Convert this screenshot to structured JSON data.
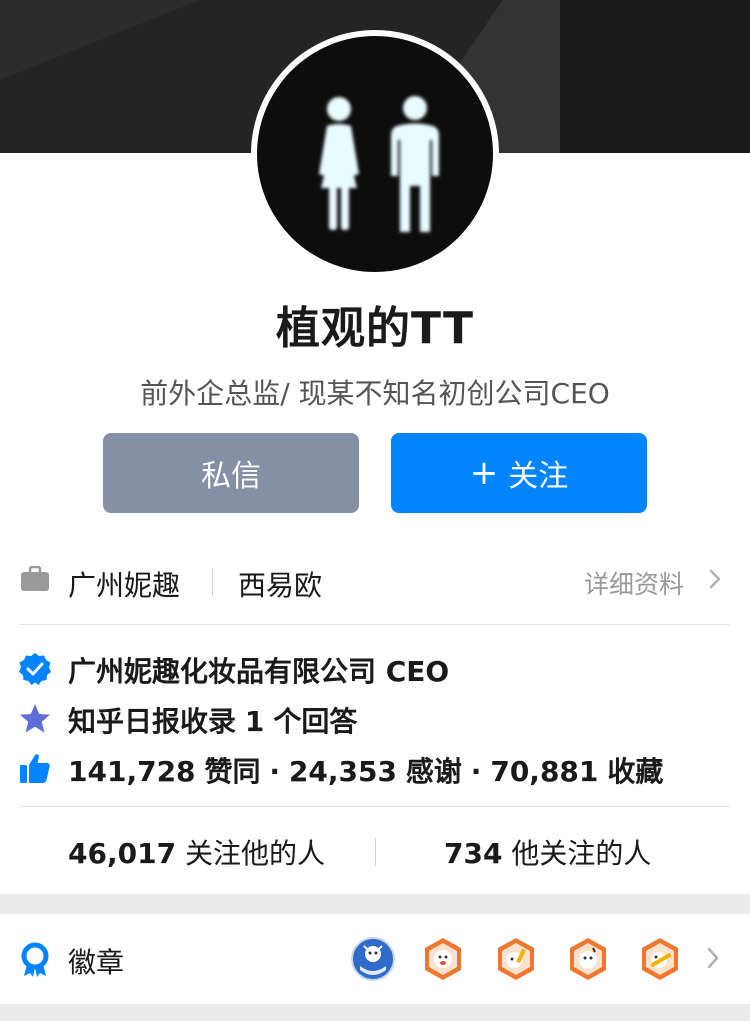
{
  "profile": {
    "name": "植观的TT",
    "headline": "前外企总监/ 现某不知名初创公司CEO"
  },
  "actions": {
    "message_label": "私信",
    "follow_plus": "+",
    "follow_label": "关注"
  },
  "employment": {
    "company": "广州妮趣",
    "position": "西易欧",
    "detail_link": "详细资料"
  },
  "highlights": {
    "verification": "广州妮趣化妆品有限公司 CEO",
    "zhihu_daily_prefix": "知乎日报收录",
    "zhihu_daily_count": "1",
    "zhihu_daily_suffix": "个回答",
    "likes": "141,728",
    "likes_label": "赞同",
    "thanks": "24,353",
    "thanks_label": "感谢",
    "favorites": "70,881",
    "favorites_label": "收藏",
    "dot": "·"
  },
  "follow_stats": {
    "followers": "46,017",
    "followers_label": "关注他的人",
    "following": "734",
    "following_label": "他关注的人"
  },
  "badges": {
    "label": "徽章",
    "items": [
      "shield-badge",
      "hexagon-badge",
      "hexagon-badge",
      "hexagon-badge",
      "hexagon-badge"
    ]
  },
  "colors": {
    "primary": "#0084ff",
    "message_button": "#8590a6",
    "verified": "#0084ff",
    "star": "#5f6ed8",
    "badge_orange": "#f0782e"
  }
}
